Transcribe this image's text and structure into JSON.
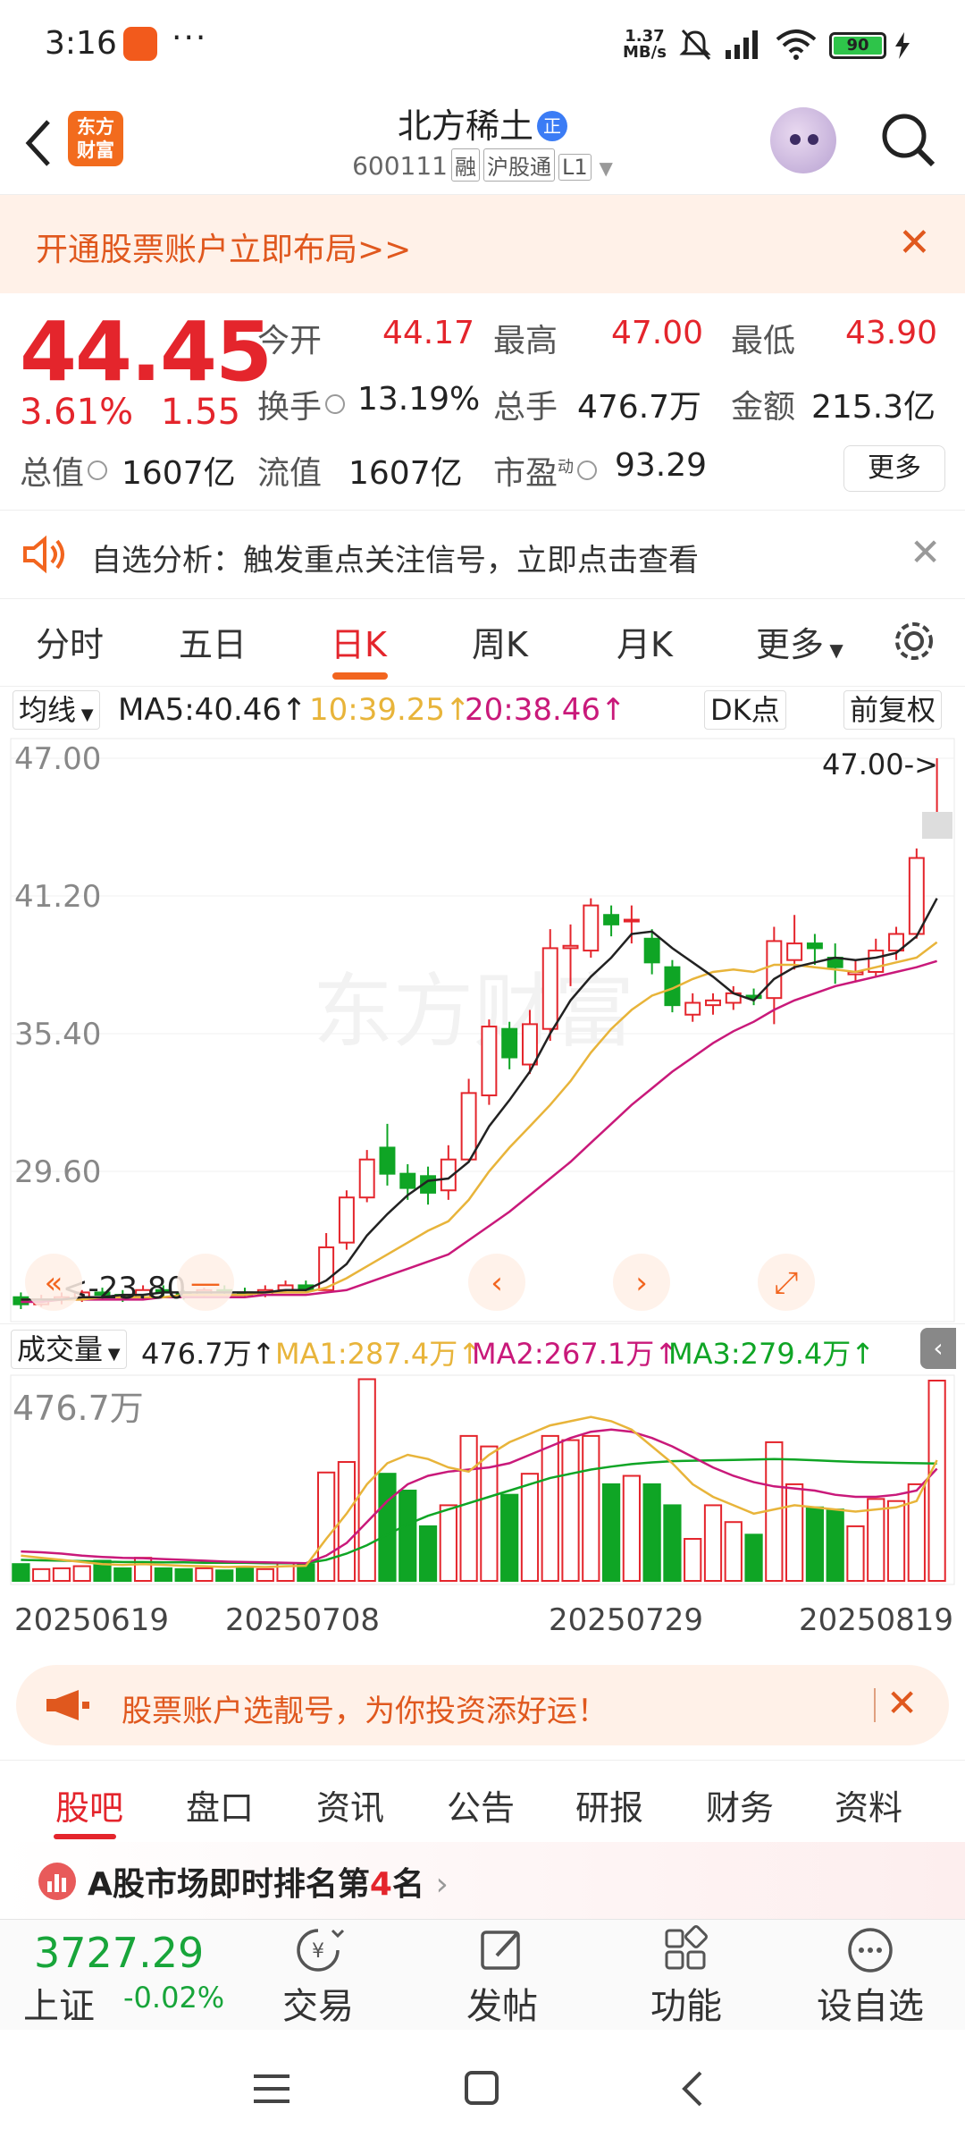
{
  "status": {
    "time": "3:16",
    "more": "···",
    "net_speed": "1.37",
    "net_unit": "MB/s",
    "battery": "90"
  },
  "header": {
    "logo_line1": "东方",
    "logo_line2": "财富",
    "title": "北方稀土",
    "title_badge": "正",
    "code": "600111",
    "tag1": "融",
    "tag2": "沪股通",
    "tag3": "L1"
  },
  "promo": {
    "text": "开通股票账户立即布局>>",
    "close": "✕"
  },
  "quote": {
    "price": "44.45",
    "change_pct": "3.61%",
    "change": "1.55",
    "open_label": "今开",
    "open": "44.17",
    "high_label": "最高",
    "high": "47.00",
    "low_label": "最低",
    "low": "43.90",
    "turnover_label": "换手",
    "turnover": "13.19%",
    "volume_label": "总手",
    "volume": "476.7万",
    "amount_label": "金额",
    "amount": "215.3亿",
    "mktcap_label": "总值",
    "mktcap": "1607亿",
    "float_label": "流值",
    "float": "1607亿",
    "pe_label": "市盈",
    "pe_sup": "动",
    "pe": "93.29",
    "more_button": "更多"
  },
  "analysis": {
    "text": "自选分析：触发重点关注信号，立即点击查看",
    "close": "✕"
  },
  "tabs": [
    "分时",
    "五日",
    "日K",
    "周K",
    "月K",
    "更多"
  ],
  "chart_bar": {
    "ma_select": "均线",
    "ma5": "MA5:40.46",
    "ma10": "10:39.25",
    "ma20": "20:38.46",
    "dk_button": "DK点",
    "adjust_button": "前复权"
  },
  "kline": {
    "y_labels": [
      "47.00",
      "41.20",
      "35.40",
      "29.60"
    ],
    "max_marker": "47.00->",
    "min_marker": "<-23.80",
    "watermark": "东方财富"
  },
  "volume_bar": {
    "select": "成交量",
    "vol": "476.7万",
    "ma1": "MA1:287.4万",
    "ma2": "MA2:267.1万",
    "ma3": "MA3:279.4万",
    "y_label": "476.7万"
  },
  "dates": [
    "20250619",
    "20250708",
    "20250729",
    "20250819"
  ],
  "promo2": {
    "text": "股票账户选靓号，为你投资添好运！",
    "close": "✕"
  },
  "subtabs": [
    "股吧",
    "盘口",
    "资讯",
    "公告",
    "研报",
    "财务",
    "资料"
  ],
  "rank": {
    "prefix": "A股市场即时排名第",
    "num": "4",
    "suffix": "名",
    "arrow": "›"
  },
  "bottom": {
    "index_value": "3727.29",
    "index_name": "上证",
    "index_change": "-0.02%",
    "trade": "交易",
    "post": "发帖",
    "func": "功能",
    "watch": "设自选"
  },
  "colors": {
    "up": "#e4252c",
    "down": "#0fa525",
    "ma5": "#222222",
    "ma10": "#e8b43a",
    "ma20": "#c9197a",
    "accent": "#f2651f"
  },
  "chart_data": {
    "type": "candlestick",
    "y_range": [
      23.8,
      47.0
    ],
    "x_ticks": [
      "20250619",
      "20250708",
      "20250729",
      "20250819"
    ],
    "candles": [
      {
        "o": 24.3,
        "c": 24.0,
        "h": 24.5,
        "l": 23.8
      },
      {
        "o": 24.0,
        "c": 24.2,
        "h": 24.4,
        "l": 23.9
      },
      {
        "o": 24.2,
        "c": 24.3,
        "h": 24.5,
        "l": 24.0
      },
      {
        "o": 24.3,
        "c": 24.5,
        "h": 24.6,
        "l": 24.1
      },
      {
        "o": 24.5,
        "c": 24.4,
        "h": 24.7,
        "l": 24.2
      },
      {
        "o": 24.4,
        "c": 24.3,
        "h": 24.6,
        "l": 24.1
      },
      {
        "o": 24.3,
        "c": 24.6,
        "h": 24.8,
        "l": 24.2
      },
      {
        "o": 24.6,
        "c": 24.5,
        "h": 24.8,
        "l": 24.3
      },
      {
        "o": 24.5,
        "c": 24.4,
        "h": 24.6,
        "l": 24.2
      },
      {
        "o": 24.4,
        "c": 24.6,
        "h": 24.7,
        "l": 24.3
      },
      {
        "o": 24.6,
        "c": 24.5,
        "h": 24.8,
        "l": 24.4
      },
      {
        "o": 24.5,
        "c": 24.4,
        "h": 24.7,
        "l": 24.3
      },
      {
        "o": 24.4,
        "c": 24.6,
        "h": 24.8,
        "l": 24.3
      },
      {
        "o": 24.6,
        "c": 24.8,
        "h": 25.0,
        "l": 24.5
      },
      {
        "o": 24.8,
        "c": 24.6,
        "h": 25.0,
        "l": 24.5
      },
      {
        "o": 24.6,
        "c": 26.4,
        "h": 27.0,
        "l": 24.6
      },
      {
        "o": 26.6,
        "c": 28.5,
        "h": 28.8,
        "l": 26.3
      },
      {
        "o": 28.5,
        "c": 30.1,
        "h": 30.5,
        "l": 28.3
      },
      {
        "o": 30.6,
        "c": 29.5,
        "h": 31.6,
        "l": 29.0
      },
      {
        "o": 29.5,
        "c": 28.9,
        "h": 29.9,
        "l": 28.4
      },
      {
        "o": 29.4,
        "c": 28.7,
        "h": 29.8,
        "l": 28.2
      },
      {
        "o": 28.8,
        "c": 30.1,
        "h": 30.7,
        "l": 28.4
      },
      {
        "o": 30.1,
        "c": 32.9,
        "h": 33.5,
        "l": 30.0
      },
      {
        "o": 32.8,
        "c": 35.7,
        "h": 36.0,
        "l": 32.4
      },
      {
        "o": 35.6,
        "c": 34.4,
        "h": 35.9,
        "l": 33.9
      },
      {
        "o": 34.1,
        "c": 35.8,
        "h": 36.4,
        "l": 33.7
      },
      {
        "o": 35.6,
        "c": 39.0,
        "h": 39.8,
        "l": 35.1
      },
      {
        "o": 39.0,
        "c": 39.1,
        "h": 40.0,
        "l": 37.4
      },
      {
        "o": 38.9,
        "c": 40.8,
        "h": 41.1,
        "l": 38.6
      },
      {
        "o": 40.4,
        "c": 40.0,
        "h": 40.8,
        "l": 39.5
      },
      {
        "o": 40.2,
        "c": 40.2,
        "h": 40.8,
        "l": 39.2
      },
      {
        "o": 39.4,
        "c": 38.4,
        "h": 39.8,
        "l": 37.9
      },
      {
        "o": 38.2,
        "c": 36.6,
        "h": 38.5,
        "l": 36.3
      },
      {
        "o": 36.2,
        "c": 36.7,
        "h": 37.1,
        "l": 35.9
      },
      {
        "o": 36.6,
        "c": 36.8,
        "h": 37.1,
        "l": 36.2
      },
      {
        "o": 36.7,
        "c": 37.1,
        "h": 37.4,
        "l": 36.4
      },
      {
        "o": 37.0,
        "c": 36.9,
        "h": 37.3,
        "l": 36.6
      },
      {
        "o": 36.9,
        "c": 39.3,
        "h": 39.9,
        "l": 35.8
      },
      {
        "o": 38.5,
        "c": 39.2,
        "h": 40.4,
        "l": 38.1
      },
      {
        "o": 39.2,
        "c": 39.0,
        "h": 39.6,
        "l": 38.3
      },
      {
        "o": 38.6,
        "c": 38.2,
        "h": 39.2,
        "l": 37.5
      },
      {
        "o": 37.9,
        "c": 38.0,
        "h": 38.5,
        "l": 37.6
      },
      {
        "o": 38.0,
        "c": 38.9,
        "h": 39.4,
        "l": 37.8
      },
      {
        "o": 38.9,
        "c": 39.6,
        "h": 39.9,
        "l": 38.5
      },
      {
        "o": 39.6,
        "c": 42.8,
        "h": 43.2,
        "l": 39.4
      },
      {
        "o": 44.2,
        "c": 44.45,
        "h": 47.0,
        "l": 43.9
      }
    ],
    "ma5": [
      24.2,
      24.2,
      24.2,
      24.3,
      24.3,
      24.4,
      24.4,
      24.5,
      24.5,
      24.5,
      24.5,
      24.5,
      24.5,
      24.6,
      24.6,
      25.0,
      25.7,
      26.9,
      27.8,
      28.6,
      29.2,
      29.3,
      30.0,
      31.5,
      32.6,
      33.8,
      35.4,
      36.8,
      37.8,
      38.6,
      39.6,
      39.7,
      39.0,
      38.4,
      37.8,
      37.1,
      36.8,
      37.7,
      38.2,
      38.4,
      38.6,
      38.5,
      38.6,
      38.8,
      39.5,
      41.1
    ],
    "ma10": [
      24.2,
      24.2,
      24.2,
      24.2,
      24.3,
      24.3,
      24.3,
      24.3,
      24.4,
      24.4,
      24.4,
      24.4,
      24.5,
      24.5,
      24.5,
      24.7,
      25.1,
      25.6,
      26.1,
      26.6,
      27.1,
      27.5,
      28.4,
      29.6,
      30.6,
      31.5,
      32.4,
      33.4,
      34.6,
      35.6,
      36.4,
      37.0,
      37.3,
      37.7,
      38.0,
      38.1,
      38.0,
      38.3,
      38.3,
      38.2,
      38.1,
      38.0,
      38.2,
      38.4,
      38.6,
      39.25
    ],
    "ma20": [
      24.1,
      24.1,
      24.2,
      24.2,
      24.2,
      24.2,
      24.2,
      24.3,
      24.3,
      24.3,
      24.3,
      24.3,
      24.4,
      24.4,
      24.4,
      24.5,
      24.6,
      24.9,
      25.2,
      25.5,
      25.8,
      26.1,
      26.7,
      27.3,
      27.9,
      28.6,
      29.3,
      30.0,
      30.8,
      31.6,
      32.4,
      33.1,
      33.8,
      34.4,
      35.0,
      35.5,
      35.9,
      36.4,
      36.8,
      37.1,
      37.4,
      37.6,
      37.8,
      38.0,
      38.2,
      38.46
    ],
    "volume": [
      40,
      28,
      30,
      35,
      48,
      30,
      55,
      30,
      28,
      30,
      25,
      30,
      28,
      42,
      40,
      258,
      283,
      480,
      255,
      215,
      130,
      180,
      345,
      320,
      205,
      255,
      345,
      335,
      345,
      230,
      250,
      230,
      180,
      100,
      180,
      140,
      110,
      330,
      230,
      175,
      170,
      130,
      195,
      190,
      230,
      476.7
    ],
    "volume_ma1": [
      60,
      55,
      50,
      45,
      40,
      38,
      40,
      38,
      36,
      35,
      33,
      34,
      33,
      35,
      36,
      100,
      160,
      230,
      280,
      300,
      290,
      270,
      260,
      300,
      330,
      350,
      370,
      380,
      390,
      380,
      360,
      320,
      280,
      230,
      200,
      180,
      160,
      170,
      180,
      175,
      170,
      165,
      170,
      175,
      190,
      287.4
    ],
    "volume_ma2": [
      70,
      68,
      65,
      60,
      57,
      55,
      54,
      52,
      50,
      48,
      46,
      45,
      44,
      43,
      42,
      60,
      90,
      140,
      190,
      230,
      250,
      260,
      265,
      270,
      280,
      300,
      320,
      340,
      355,
      360,
      355,
      340,
      320,
      295,
      270,
      250,
      235,
      225,
      220,
      215,
      205,
      200,
      200,
      205,
      215,
      267.1
    ],
    "volume_ma3": [
      50,
      49,
      48,
      47,
      46,
      45,
      45,
      44,
      44,
      43,
      43,
      43,
      42,
      42,
      42,
      50,
      65,
      85,
      110,
      135,
      155,
      170,
      185,
      200,
      215,
      230,
      245,
      255,
      265,
      272,
      278,
      282,
      285,
      286,
      287,
      288,
      289,
      290,
      289,
      287,
      285,
      283,
      282,
      281,
      280,
      279.4
    ]
  }
}
